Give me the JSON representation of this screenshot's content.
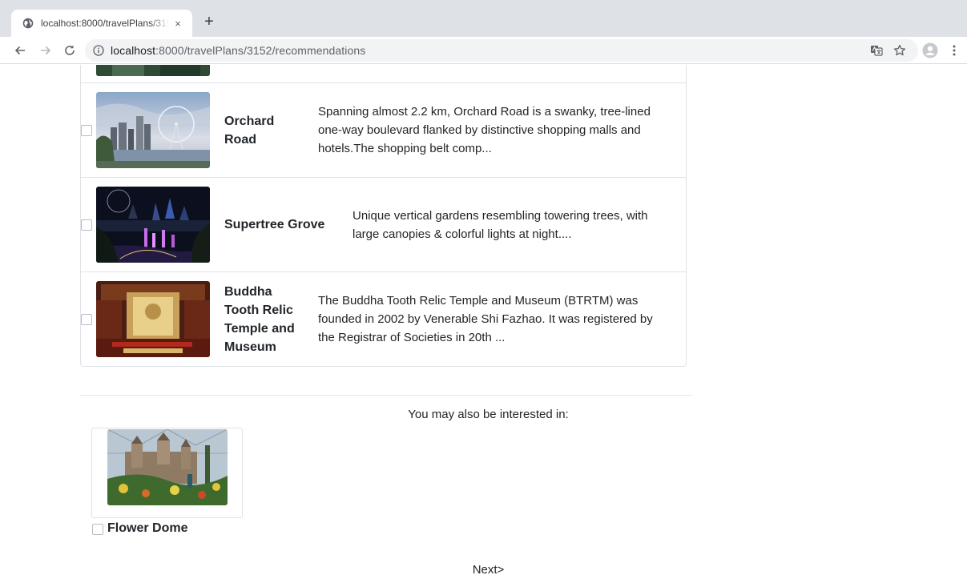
{
  "browser": {
    "tab_title": "localhost:8000/travelPlans/3152/recommendations",
    "tab_close": "×",
    "new_tab": "+",
    "url_host": "localhost",
    "url_rest": ":8000/travelPlans/3152/recommendations",
    "icons": {
      "favicon": "globe-icon",
      "back": "back-arrow-icon",
      "forward": "forward-arrow-icon",
      "reload": "reload-icon",
      "info": "info-icon",
      "translate": "translate-icon",
      "bookmark": "star-icon",
      "profile": "avatar-icon",
      "menu": "kebab-menu-icon"
    }
  },
  "places": [
    {
      "name_lines": [
        "Orchard",
        "Road"
      ],
      "description_lines": [
        "Spanning almost 2.2 km, Orchard Road is a swanky, tree-lined",
        "one-way boulevard flanked by distinctive shopping malls and",
        "hotels.The shopping belt comp..."
      ],
      "checked": false
    },
    {
      "name_lines": [
        "Supertree Grove"
      ],
      "description_lines": [
        "Unique vertical gardens resembling towering trees, with",
        "large canopies & colorful lights at night...."
      ],
      "checked": false
    },
    {
      "name_lines": [
        "Buddha",
        "Tooth Relic",
        "Temple and",
        "Museum"
      ],
      "description_lines": [
        "The Buddha Tooth Relic Temple and Museum (BTRTM) was",
        "founded in 2002 by Venerable Shi Fazhao. It was registered by",
        "the Registrar of Societies in 20th ..."
      ],
      "checked": false
    }
  ],
  "also_interested": {
    "title": "You may also be interested in:",
    "items": [
      {
        "name": "Flower Dome",
        "checked": false
      }
    ]
  },
  "next_label": "Next>",
  "colors": {
    "tabstrip": "#dee1e6",
    "omnibox": "#f1f3f4",
    "border": "#dee2e6",
    "text": "#212529"
  }
}
